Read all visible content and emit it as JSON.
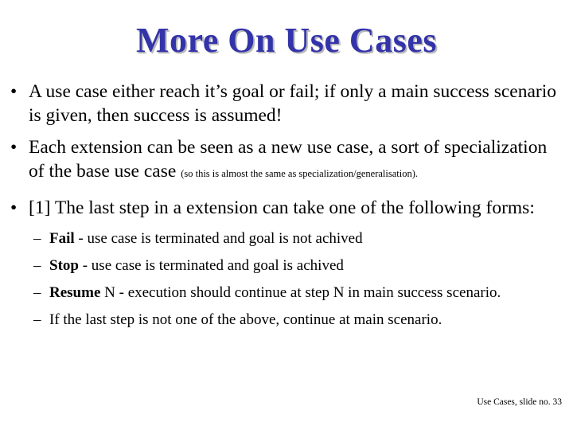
{
  "slide": {
    "title": "More On Use Cases",
    "title_color": "#3333AA",
    "shadow_color": "#B9B9B9",
    "background_color": "#FFFFFF",
    "text_color": "#000000"
  },
  "bullets": [
    {
      "marker": "•",
      "text": "A use case either reach it’s goal or fail; if only a main success scenario is given, then success is assumed!",
      "note": ""
    },
    {
      "marker": "•",
      "text": "Each extension can be seen as a new use case, a sort of specialization of the base use case ",
      "note": "(so this is almost the same as specialization/generalisation)."
    },
    {
      "marker": "•",
      "text": "[1] The last step in a extension can take one of the following forms:",
      "note": ""
    }
  ],
  "sub_bullets": [
    {
      "marker": "–",
      "keyword": "Fail",
      "rest": " - use case is terminated and goal is not achived"
    },
    {
      "marker": "–",
      "keyword": "Stop",
      "rest": " - use case is terminated and goal is achived"
    },
    {
      "marker": "–",
      "keyword": "Resume",
      "rest": " N - execution should continue at step N in main success scenario."
    },
    {
      "marker": "–",
      "keyword": "",
      "rest": "If the last step is not one of the above, continue at main scenario."
    }
  ],
  "footer": {
    "text": "Use Cases, slide no. 33"
  }
}
